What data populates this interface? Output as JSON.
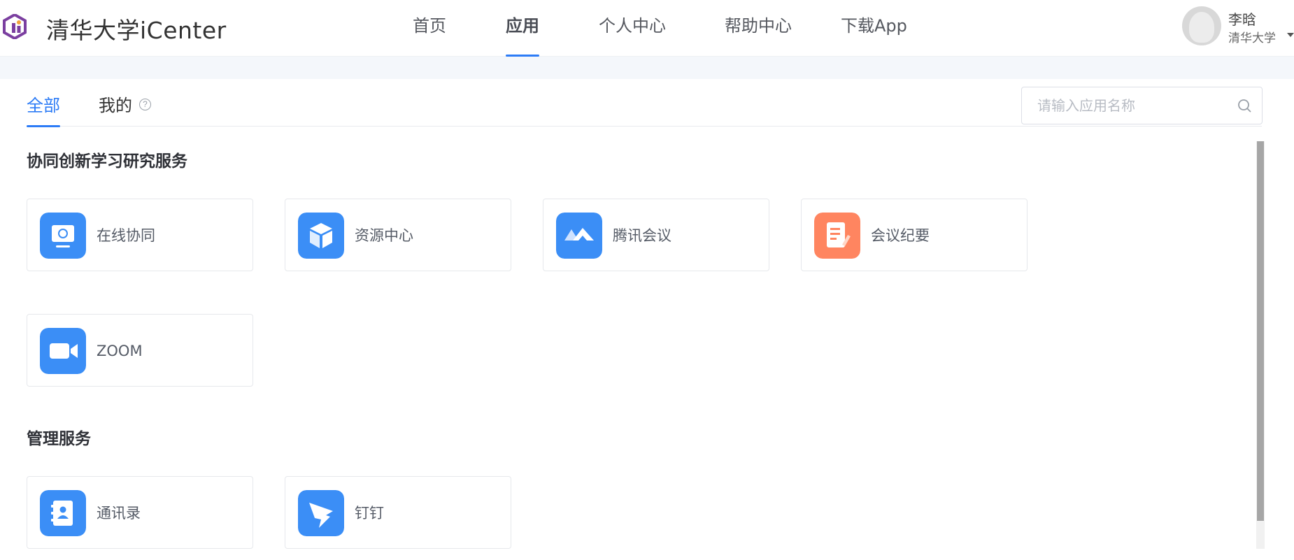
{
  "header": {
    "brand": "清华大学iCenter",
    "nav": [
      {
        "label": "首页",
        "active": false
      },
      {
        "label": "应用",
        "active": true
      },
      {
        "label": "个人中心",
        "active": false
      },
      {
        "label": "帮助中心",
        "active": false
      },
      {
        "label": "下载App",
        "active": false
      }
    ],
    "user": {
      "name": "李晗",
      "org": "清华大学"
    }
  },
  "tabs": [
    {
      "label": "全部",
      "active": true
    },
    {
      "label": "我的",
      "active": false,
      "help_icon": "?"
    }
  ],
  "search": {
    "placeholder": "请输入应用名称",
    "value": ""
  },
  "sections": [
    {
      "title": "协同创新学习研究服务",
      "apps": [
        {
          "label": "在线协同",
          "icon": "monitor-sync-icon",
          "color": "#3b8ef6"
        },
        {
          "label": "资源中心",
          "icon": "cube-icon",
          "color": "#3b8ef6"
        },
        {
          "label": "腾讯会议",
          "icon": "tencent-meeting-icon",
          "color": "#3b8ef6"
        },
        {
          "label": "会议纪要",
          "icon": "notes-icon",
          "color": "#ff8560"
        },
        {
          "label": "ZOOM",
          "icon": "video-camera-icon",
          "color": "#3b8ef6"
        }
      ]
    },
    {
      "title": "管理服务",
      "apps": [
        {
          "label": "通讯录",
          "icon": "contacts-icon",
          "color": "#3b8ef6"
        },
        {
          "label": "钉钉",
          "icon": "dingtalk-icon",
          "color": "#3b8ef6"
        }
      ]
    }
  ],
  "colors": {
    "accent": "#2d7cf6",
    "brand_purple": "#7b3fa0"
  }
}
